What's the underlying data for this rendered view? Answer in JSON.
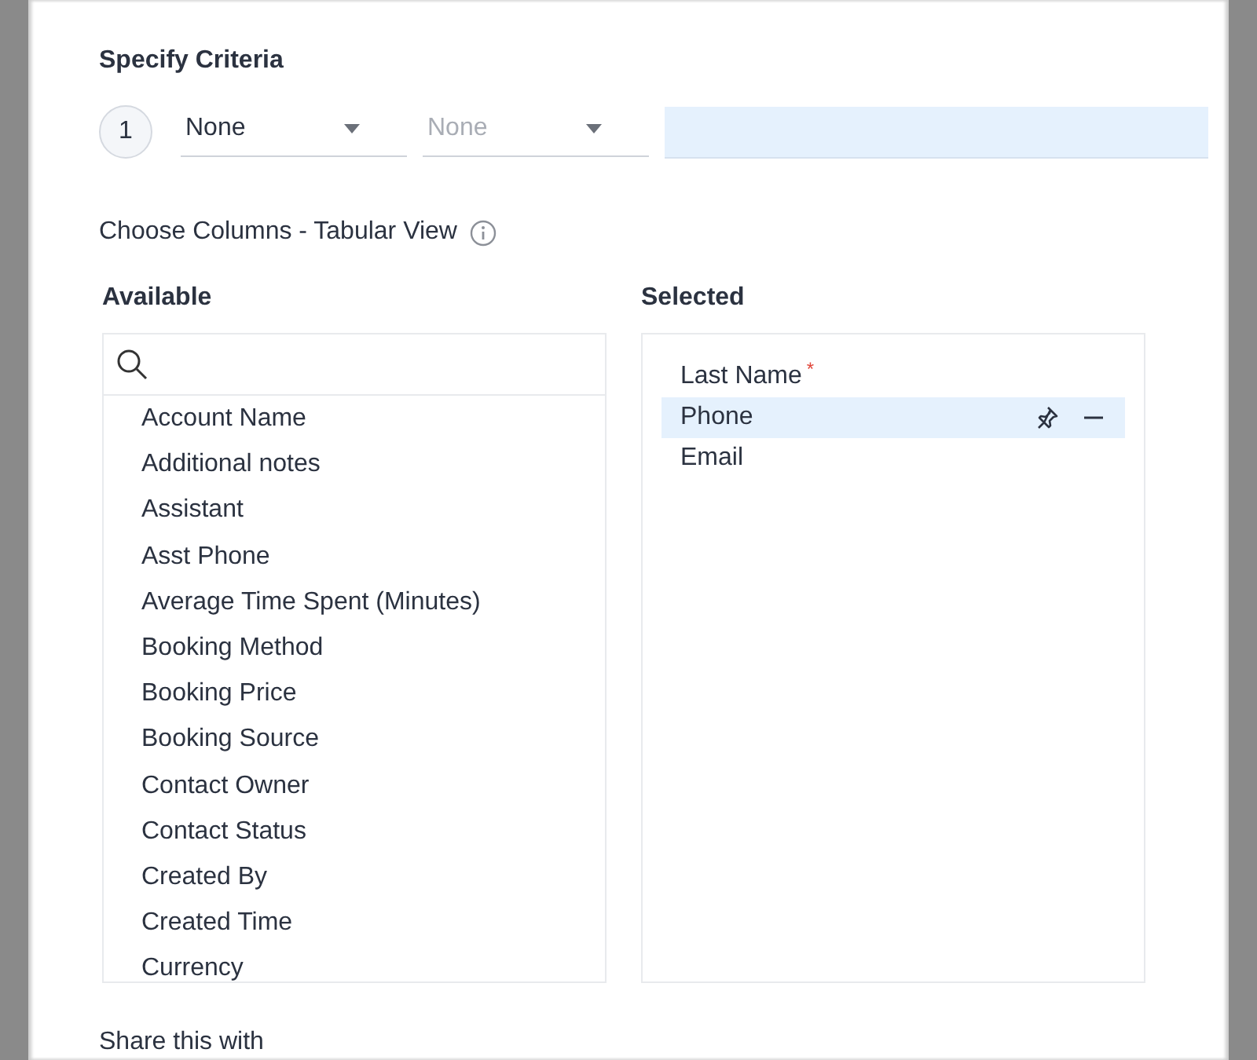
{
  "criteria": {
    "title": "Specify Criteria",
    "rows": [
      {
        "number": "1",
        "field": {
          "value": "None",
          "disabled": false
        },
        "operator": {
          "value": "None",
          "disabled": true
        }
      }
    ]
  },
  "columns": {
    "title": "Choose Columns - Tabular View",
    "available": {
      "heading": "Available",
      "items": [
        "Account Name",
        "Additional notes",
        "Assistant",
        "Asst Phone",
        "Average Time Spent (Minutes)",
        "Booking Method",
        "Booking Price",
        "Booking Source",
        "Contact Owner",
        "Contact Status",
        "Created By",
        "Created Time",
        "Currency"
      ]
    },
    "selected": {
      "heading": "Selected",
      "items": [
        {
          "label": "Last Name",
          "required_mark": "*",
          "selected": false
        },
        {
          "label": "Phone",
          "selected": true
        },
        {
          "label": "Email",
          "selected": false
        }
      ]
    }
  },
  "share": {
    "title": "Share this with"
  }
}
